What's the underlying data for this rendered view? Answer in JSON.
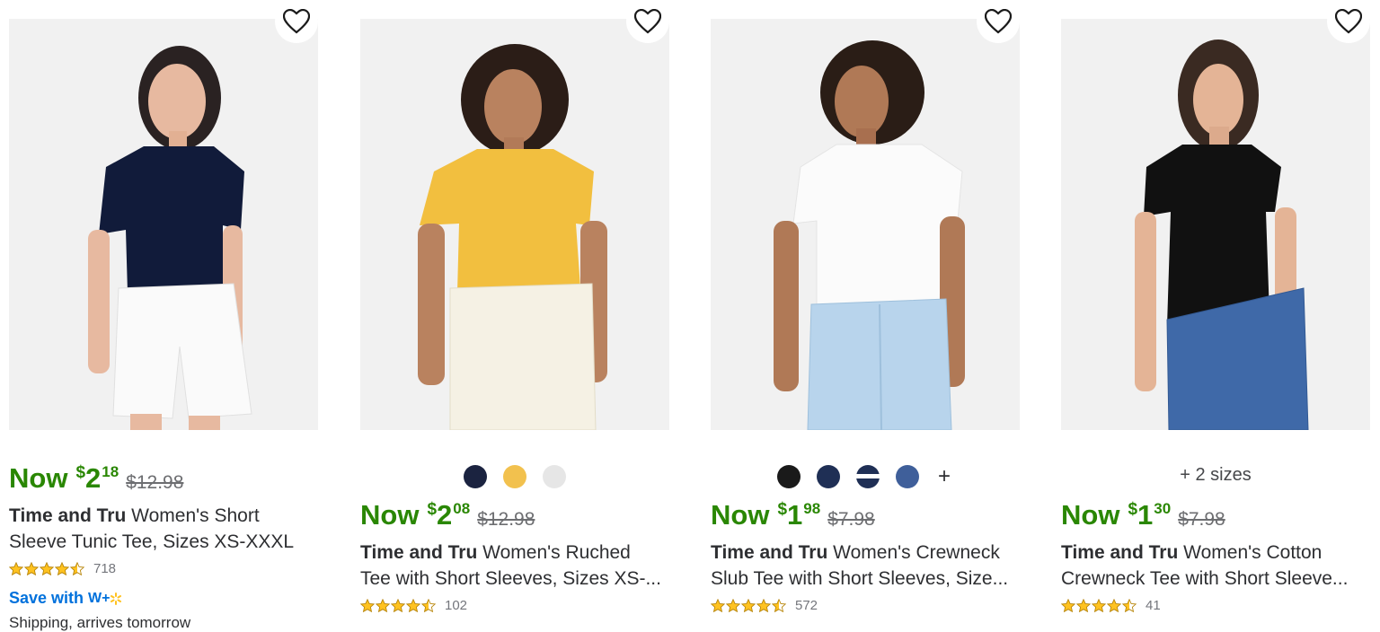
{
  "products": [
    {
      "price_prefix": "Now",
      "price_dollars": "2",
      "price_cents": "18",
      "currency": "$",
      "was_price": "$12.98",
      "brand": "Time and Tru",
      "title_line1": "Women's Short",
      "title_line2": "Sleeve Tunic Tee, Sizes XS-XXXL",
      "rating": 4.5,
      "review_count": "718",
      "save_label": "Save with",
      "save_badge": "W+",
      "shipping_note": "Shipping, arrives tomorrow"
    },
    {
      "price_prefix": "Now",
      "price_dollars": "2",
      "price_cents": "08",
      "currency": "$",
      "was_price": "$12.98",
      "brand": "Time and Tru",
      "title_line1": "Women's Ruched",
      "title_line2": "Tee with Short Sleeves, Sizes XS-...",
      "rating": 4.5,
      "review_count": "102",
      "swatches": [
        "#1b2340",
        "#f2c14e",
        "#e6e6e6"
      ]
    },
    {
      "price_prefix": "Now",
      "price_dollars": "1",
      "price_cents": "98",
      "currency": "$",
      "was_price": "$7.98",
      "brand": "Time and Tru",
      "title_line1": "Women's Crewneck",
      "title_line2": "Slub Tee with Short Sleeves, Size...",
      "rating": 4.5,
      "review_count": "572",
      "swatches": [
        "#1a1a1a",
        "#1f2f55",
        "stripe",
        "#3f5f9a"
      ],
      "more_swatches": "+"
    },
    {
      "price_prefix": "Now",
      "price_dollars": "1",
      "price_cents": "30",
      "currency": "$",
      "was_price": "$7.98",
      "brand": "Time and Tru",
      "title_line1": "Women's Cotton",
      "title_line2": "Crewneck Tee with Short Sleeve...",
      "rating": 4.5,
      "review_count": "41",
      "sizes_note": "+ 2 sizes"
    }
  ],
  "icons": {
    "favorite": "heart-outline-icon",
    "star": "star-icon"
  },
  "colors": {
    "price_green": "#2a8703",
    "star_yellow": "#ffc220",
    "walmart_blue": "#0071dc"
  }
}
